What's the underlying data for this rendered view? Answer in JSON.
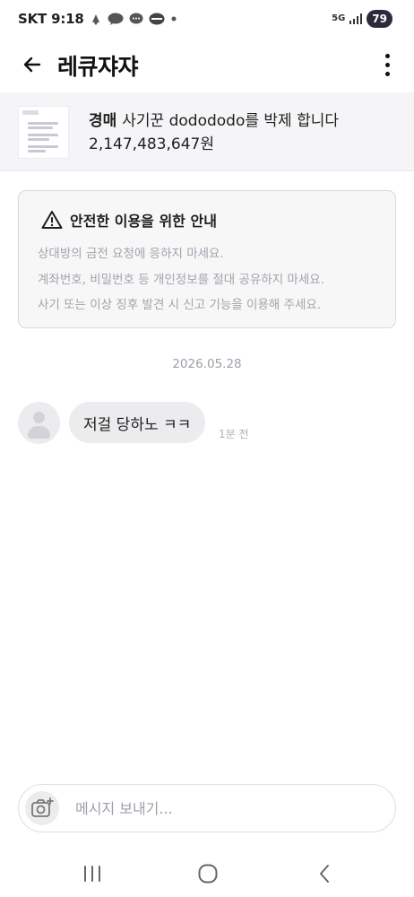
{
  "status_bar": {
    "time": "SKT 9:18",
    "battery": "79",
    "network": "5G"
  },
  "header": {
    "title": "레큐쟈쟈",
    "back_icon": "back-arrow-icon",
    "more_icon": "more-vertical-icon"
  },
  "product": {
    "type": "경매",
    "name": "사기꾼 dodododo를 박제 합니다",
    "price": "2,147,483,647원"
  },
  "notice": {
    "title": "안전한 이용을 위한 안내",
    "lines": [
      "상대방의 금전 요청에 응하지 마세요.",
      "계좌번호, 비밀번호 등 개인정보를 절대 공유하지 마세요.",
      "사기 또는 이상 징후 발견 시 신고 기능을 이용해 주세요."
    ],
    "icon": "warning-icon"
  },
  "chat": {
    "date": "2026.05.28",
    "messages": [
      {
        "text": "저걸 당하노 ㅋㅋ",
        "time": "1분 전"
      }
    ]
  },
  "composer": {
    "placeholder": "메시지 보내기...",
    "value": "",
    "camera_icon": "camera-add-icon"
  },
  "colors": {
    "accent": "#2d2a3b",
    "bubble": "#ececef",
    "product_bg": "#f5f5f7",
    "notice_bg": "#f7f7f8",
    "muted_text": "#a3a3ad"
  }
}
